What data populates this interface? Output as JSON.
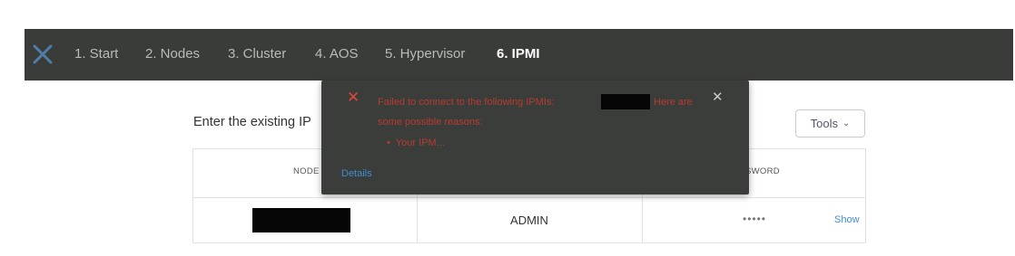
{
  "wizard": {
    "logo_icon": "nutanix-x-logo",
    "steps": [
      {
        "label": "1. Start",
        "active": false
      },
      {
        "label": "2. Nodes",
        "active": false
      },
      {
        "label": "3. Cluster",
        "active": false
      },
      {
        "label": "4. AOS",
        "active": false
      },
      {
        "label": "5. Hypervisor",
        "active": false
      },
      {
        "label": "6. IPMI",
        "active": true
      }
    ]
  },
  "main": {
    "intro_text": "Enter the existing IP",
    "tools_button": {
      "label": "Tools",
      "icon": "chevron-down-icon",
      "caret": "⌄"
    }
  },
  "table": {
    "headers": {
      "node": "NODE",
      "password": "SWORD"
    },
    "rows": [
      {
        "node": "",
        "username": "ADMIN",
        "password_masked": "•••••",
        "show_label": "Show"
      }
    ]
  },
  "error_popover": {
    "icon": "error-x-icon",
    "icon_glyph": "✕",
    "line1_a": "Failed to connect to the following IPMIs:",
    "line1_b": "Here are",
    "line2": "some possible reasons:",
    "bullet": "Your IPM...",
    "bullet_glyph": "•",
    "close_glyph": "✕",
    "details_label": "Details"
  },
  "colors": {
    "topbar_bg": "#3a3c39",
    "popover_bg": "#3b3d3a",
    "error_text": "#b63b31",
    "error_icon": "#e0463c",
    "link": "#3f8ed3"
  }
}
